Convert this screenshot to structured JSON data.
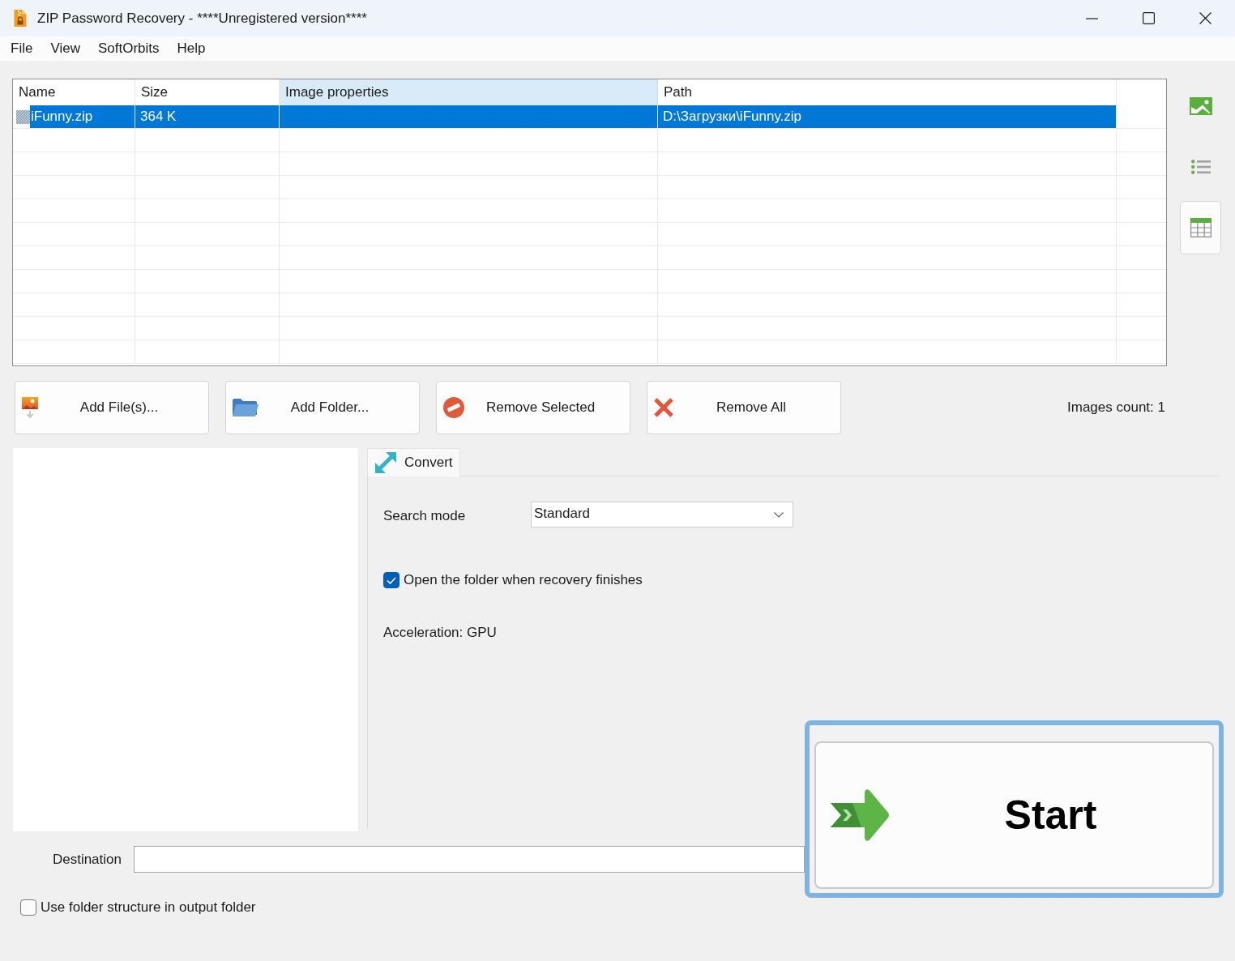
{
  "window": {
    "title": "ZIP Password Recovery - ****Unregistered version****"
  },
  "menu": [
    {
      "label": "File"
    },
    {
      "label": "View"
    },
    {
      "label": "SoftOrbits"
    },
    {
      "label": "Help"
    }
  ],
  "file_table": {
    "columns": [
      {
        "label": "Name",
        "selected": false
      },
      {
        "label": "Size",
        "selected": false
      },
      {
        "label": "Image properties",
        "selected": true
      },
      {
        "label": "Path",
        "selected": false
      }
    ],
    "rows": [
      {
        "name": "iFunny.zip",
        "size": "364 K",
        "path": "D:\\Загрузки\\iFunny.zip",
        "selected": true
      }
    ]
  },
  "view_buttons": [
    {
      "kind": "thumbnails",
      "selected": false
    },
    {
      "kind": "list",
      "selected": false
    },
    {
      "kind": "details",
      "selected": true
    }
  ],
  "actions": [
    {
      "kind": "add_files",
      "label": "Add File(s)..."
    },
    {
      "kind": "add_folder",
      "label": "Add Folder..."
    },
    {
      "kind": "remove_selected",
      "label": "Remove Selected"
    },
    {
      "kind": "remove_all",
      "label": "Remove All"
    }
  ],
  "images_count": "Images count: 1",
  "tabs": [
    {
      "label": "Convert",
      "selected": true
    }
  ],
  "options": {
    "search_mode": {
      "label": "Search mode",
      "value": "Standard"
    },
    "open_folder": {
      "label": "Open the folder when recovery finishes",
      "checked": true
    },
    "acceleration": "Acceleration: GPU"
  },
  "destination": {
    "label": "Destination"
  },
  "folder_structure": {
    "label": "Use folder structure in output folder",
    "checked": false
  },
  "start_button": {
    "label": "Start",
    "focused": true
  }
}
